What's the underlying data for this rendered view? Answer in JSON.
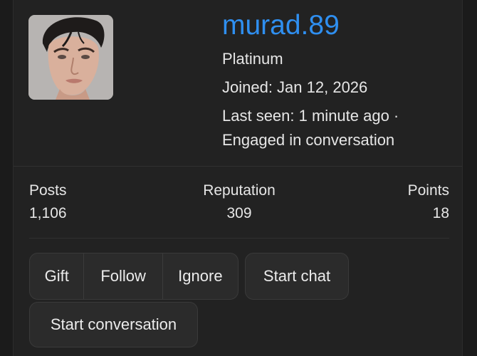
{
  "profile": {
    "username": "murad.89",
    "rank": "Platinum",
    "joined": "Joined: Jan 12, 2026",
    "last_seen": "Last seen: 1 minute ago ·",
    "activity": "Engaged in conversation"
  },
  "stats": {
    "posts_label": "Posts",
    "posts_value": "1,106",
    "reputation_label": "Reputation",
    "reputation_value": "309",
    "points_label": "Points",
    "points_value": "18"
  },
  "actions": {
    "gift": "Gift",
    "follow": "Follow",
    "ignore": "Ignore",
    "start_chat": "Start chat",
    "start_conversation": "Start conversation"
  },
  "colors": {
    "username": "#2f8ff0",
    "background": "#1b1b1b",
    "card": "#222222",
    "button": "#2b2b2b"
  }
}
